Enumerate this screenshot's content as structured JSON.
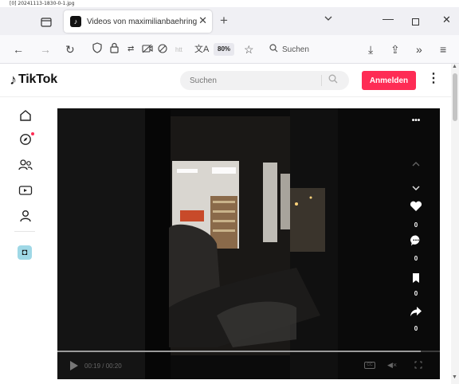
{
  "caption": "[0] 20241113-1830-0-1.jpg",
  "browser": {
    "tab_title": "Videos von maximilianbaehring",
    "tab_favicon": "tiktok-icon",
    "new_tab_label": "+",
    "zoom": "80%",
    "search_label": "Suchen",
    "url_fragment": "htt"
  },
  "tiktok": {
    "logo_text": "TikTok",
    "search_placeholder": "Suchen",
    "login_label": "Anmelden",
    "more_label": "⋮",
    "rail": [
      "home-icon",
      "explore-icon",
      "following-icon",
      "live-icon",
      "profile-icon",
      "app-icon"
    ]
  },
  "player": {
    "time": "00:19 / 00:20",
    "progress": 0.95,
    "more_label": "•••",
    "like_count": "0",
    "comment_count": "0",
    "bookmark_count": "0",
    "share_count": "0",
    "cc_label": "CC"
  },
  "colors": {
    "accent": "#fe2c55",
    "player_bg": "#0b0b0b"
  }
}
